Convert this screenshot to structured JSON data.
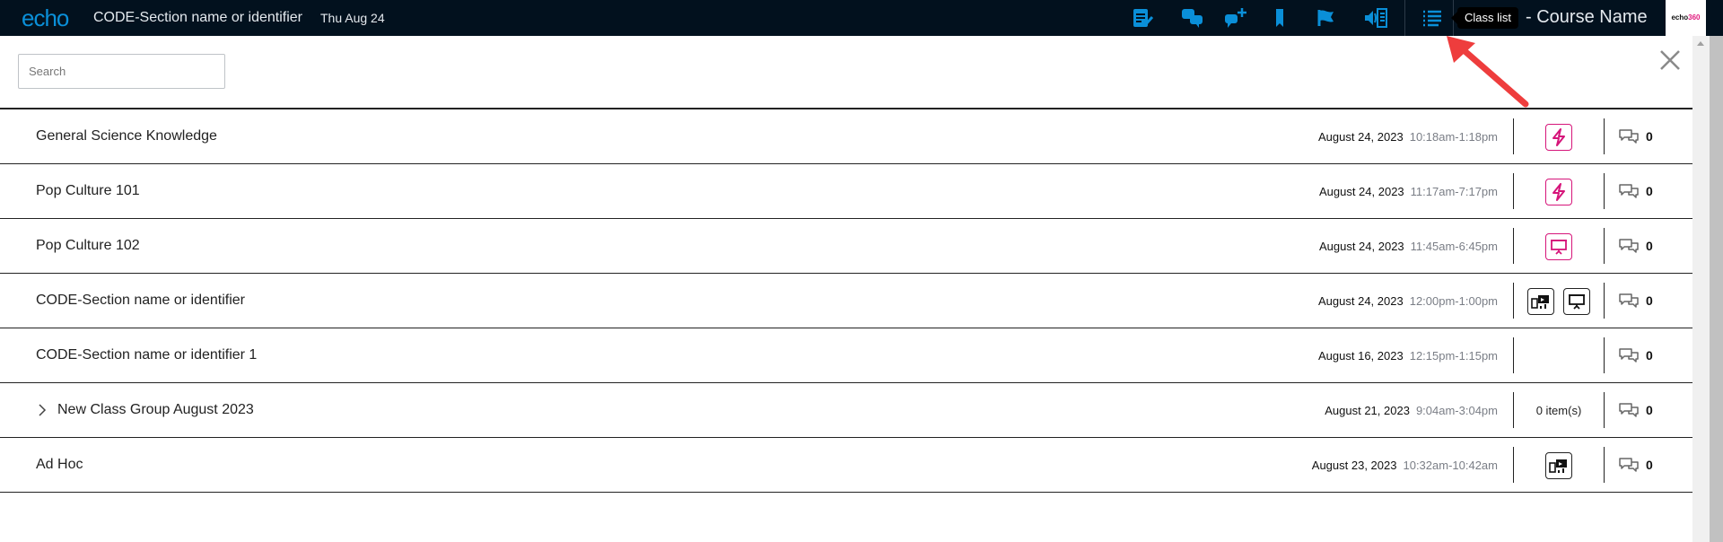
{
  "header": {
    "logo": "echo",
    "section_title": "CODE-Section name or identifier",
    "date": "Thu Aug 24",
    "tooltip": "Class list",
    "course_name": "- Course Name",
    "brand_logo": "echo360",
    "icons": [
      "notes-icon",
      "discussion-icon",
      "add-question-icon",
      "bookmark-icon",
      "flag-icon",
      "transcript-icon",
      "class-list-icon"
    ],
    "accent_color": "#0a8fd8"
  },
  "search": {
    "placeholder": "Search",
    "value": ""
  },
  "rows": [
    {
      "title": "General Science Knowledge",
      "date": "August 24, 2023",
      "time": "10:18am-1:18pm",
      "media": [
        "interactive"
      ],
      "comments": "0"
    },
    {
      "title": "Pop Culture 101",
      "date": "August 24, 2023",
      "time": "11:17am-7:17pm",
      "media": [
        "interactive"
      ],
      "comments": "0"
    },
    {
      "title": "Pop Culture 102",
      "date": "August 24, 2023",
      "time": "11:45am-6:45pm",
      "media": [
        "presentation-pink"
      ],
      "comments": "0"
    },
    {
      "title": "CODE-Section name or identifier",
      "date": "August 24, 2023",
      "time": "12:00pm-1:00pm",
      "media": [
        "video",
        "presentation"
      ],
      "comments": "0"
    },
    {
      "title": "CODE-Section name or identifier 1",
      "date": "August 16, 2023",
      "time": "12:15pm-1:15pm",
      "media": [],
      "comments": "0"
    },
    {
      "title": "New Class Group August 2023",
      "date": "August 21, 2023",
      "time": "9:04am-3:04pm",
      "group": true,
      "items": "0 item(s)",
      "comments": "0"
    },
    {
      "title": "Ad Hoc",
      "date": "August 23, 2023",
      "time": "10:32am-10:42am",
      "media": [
        "video"
      ],
      "comments": "0"
    }
  ],
  "colors": {
    "topbar": "#02111e",
    "interactive": "#d6157a"
  }
}
